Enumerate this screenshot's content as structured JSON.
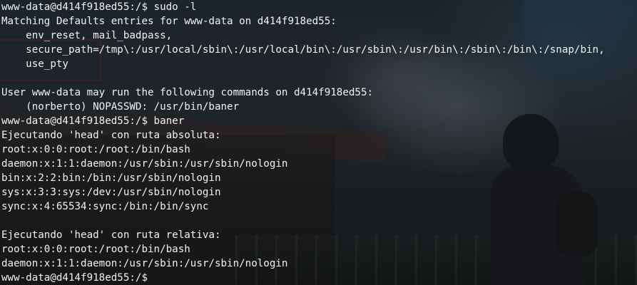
{
  "terminal": {
    "lines": [
      "www-data@d414f918ed55:/$ sudo -l",
      "Matching Defaults entries for www-data on d414f918ed55:",
      "    env_reset, mail_badpass,",
      "    secure_path=/tmp\\:/usr/local/sbin\\:/usr/local/bin\\:/usr/sbin\\:/usr/bin\\:/sbin\\:/bin\\:/snap/bin,",
      "    use_pty",
      "",
      "User www-data may run the following commands on d414f918ed55:",
      "    (norberto) NOPASSWD: /usr/bin/baner",
      "www-data@d414f918ed55:/$ baner",
      "Ejecutando 'head' con ruta absoluta:",
      "root:x:0:0:root:/root:/bin/bash",
      "daemon:x:1:1:daemon:/usr/sbin:/usr/sbin/nologin",
      "bin:x:2:2:bin:/bin:/usr/sbin/nologin",
      "sys:x:3:3:sys:/dev:/usr/sbin/nologin",
      "sync:x:4:65534:sync:/bin:/bin/sync",
      "",
      "Ejecutando 'head' con ruta relativa:",
      "root:x:0:0:root:/root:/bin/bash",
      "daemon:x:1:1:daemon:/usr/sbin:/usr/sbin/nologin",
      "www-data@d414f918ed55:/$ "
    ]
  },
  "colors": {
    "text": "#f2f2f2",
    "background": "#1f2326"
  }
}
